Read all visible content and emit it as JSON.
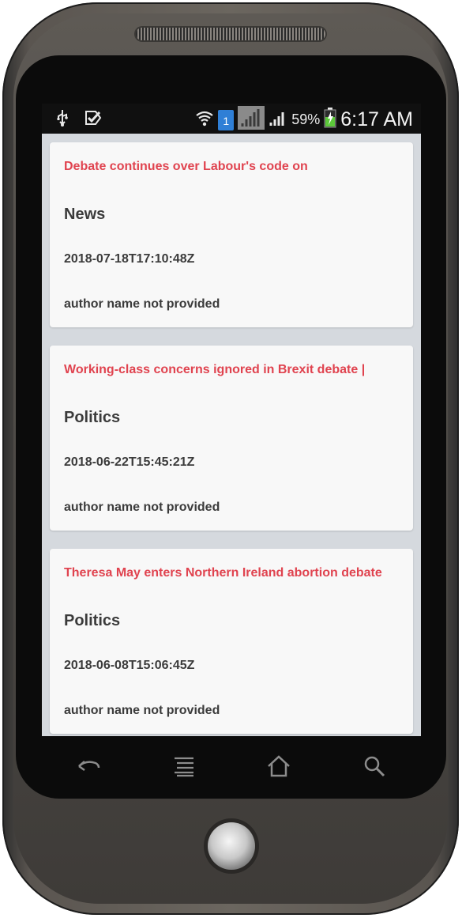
{
  "device": {
    "name": "android-phone-frame"
  },
  "statusbar": {
    "time": "6:17 AM",
    "battery_percent": "59%",
    "sim_badge": "1",
    "icons": [
      "usb-icon",
      "check-notification-icon",
      "wifi-icon",
      "sim-icon",
      "no-signal-icon",
      "signal-icon",
      "battery-charging-icon"
    ]
  },
  "articles": [
    {
      "title": "Debate continues over Labour's code on",
      "category": "News",
      "date": "2018-07-18T17:10:48Z",
      "author": "author name not provided"
    },
    {
      "title": "Working-class concerns ignored in Brexit debate |",
      "category": "Politics",
      "date": "2018-06-22T15:45:21Z",
      "author": "author name not provided"
    },
    {
      "title": "Theresa May enters Northern Ireland abortion debate",
      "category": "Politics",
      "date": "2018-06-08T15:06:45Z",
      "author": "author name not provided"
    }
  ],
  "navigation": {
    "buttons": [
      "back-icon",
      "menu-icon",
      "home-icon",
      "search-icon"
    ]
  },
  "colors": {
    "title": "#e0434f",
    "text": "#3b3b3b",
    "card_bg": "#f8f8f8",
    "list_bg": "#d5d9de",
    "statusbar_bg": "#101010"
  }
}
